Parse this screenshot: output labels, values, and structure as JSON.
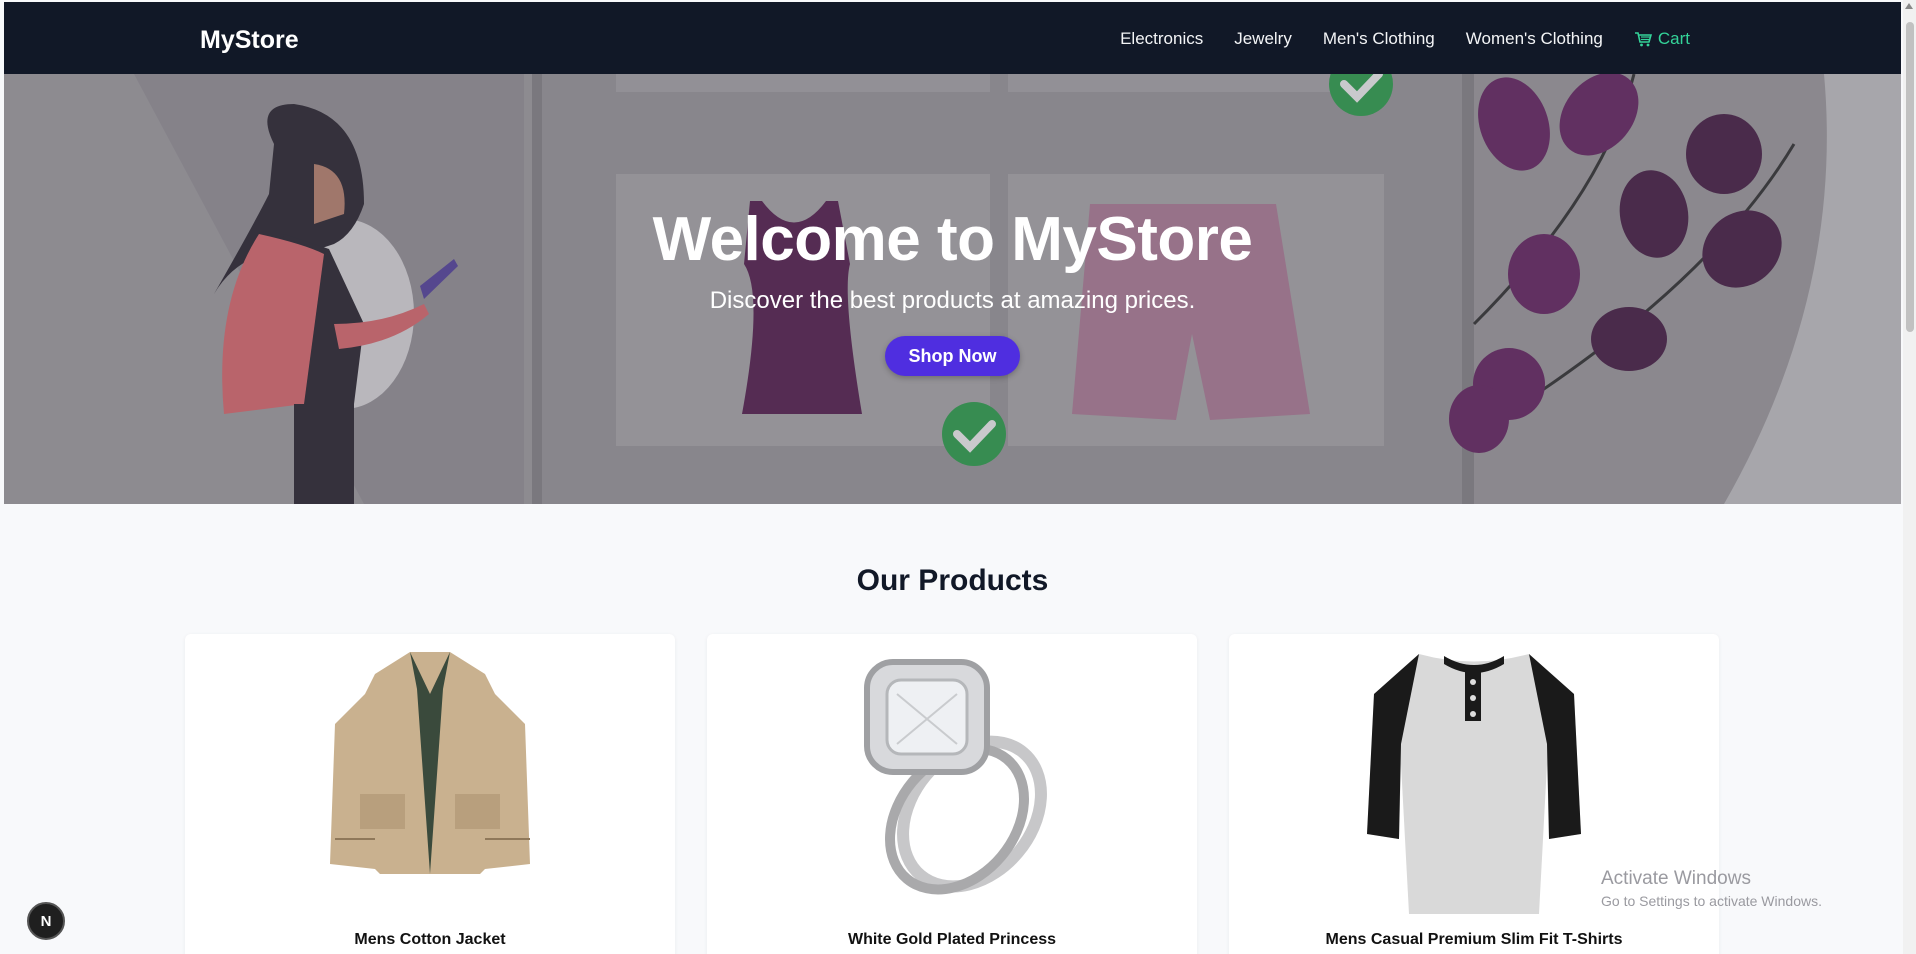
{
  "nav": {
    "brand": "MyStore",
    "links": [
      "Electronics",
      "Jewelry",
      "Men's Clothing",
      "Women's Clothing"
    ],
    "cart_label": "Cart",
    "cart_icon": "cart-icon"
  },
  "hero": {
    "title": "Welcome to MyStore",
    "subtitle": "Discover the best products at amazing prices.",
    "button": "Shop Now"
  },
  "products": {
    "heading": "Our Products",
    "items": [
      {
        "title": "Mens Cotton Jacket"
      },
      {
        "title": "White Gold Plated Princess"
      },
      {
        "title": "Mens Casual Premium Slim Fit T-Shirts"
      }
    ]
  },
  "watermark": {
    "title": "Activate Windows",
    "subtitle": "Go to Settings to activate Windows."
  },
  "badge": {
    "label": "N"
  },
  "colors": {
    "nav_bg": "#111827",
    "accent": "#4f2ee0",
    "cart": "#34d399"
  }
}
